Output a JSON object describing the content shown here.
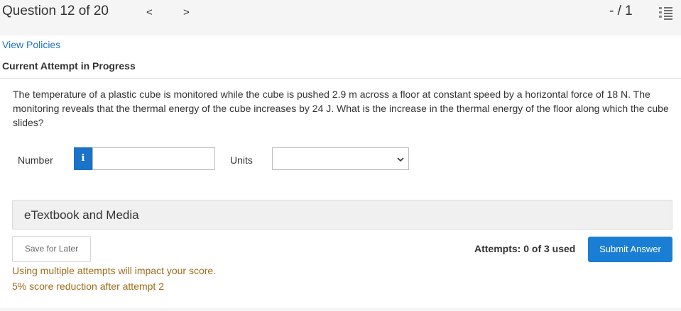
{
  "header": {
    "question_title": "Question 12 of 20",
    "prev_glyph": "<",
    "next_glyph": ">",
    "score": "- / 1",
    "list_icon": "numbered-list-icon"
  },
  "links": {
    "view_policies": "View Policies"
  },
  "attempt": {
    "heading": "Current Attempt in Progress"
  },
  "question": {
    "text": "The temperature of a plastic cube is monitored while the cube is pushed 2.9 m across a floor at constant speed by a horizontal force of 18 N. The monitoring reveals that the thermal energy of the cube increases by 24 J. What is the increase in the thermal energy of the floor along which the cube slides?"
  },
  "answer": {
    "number_label": "Number",
    "info_glyph": "i",
    "number_value": "",
    "units_label": "Units",
    "units_selected": ""
  },
  "resources": {
    "etextbook_label": "eTextbook and Media"
  },
  "actions": {
    "save_label": "Save for Later",
    "attempts_text": "Attempts: 0 of 3 used",
    "submit_label": "Submit Answer"
  },
  "warnings": {
    "line1": "Using multiple attempts will impact your score.",
    "line2": "5% score reduction after attempt 2"
  },
  "colors": {
    "link": "#1a73c8",
    "primary_button": "#1a7fd4",
    "warning_text": "#a06a1a"
  }
}
